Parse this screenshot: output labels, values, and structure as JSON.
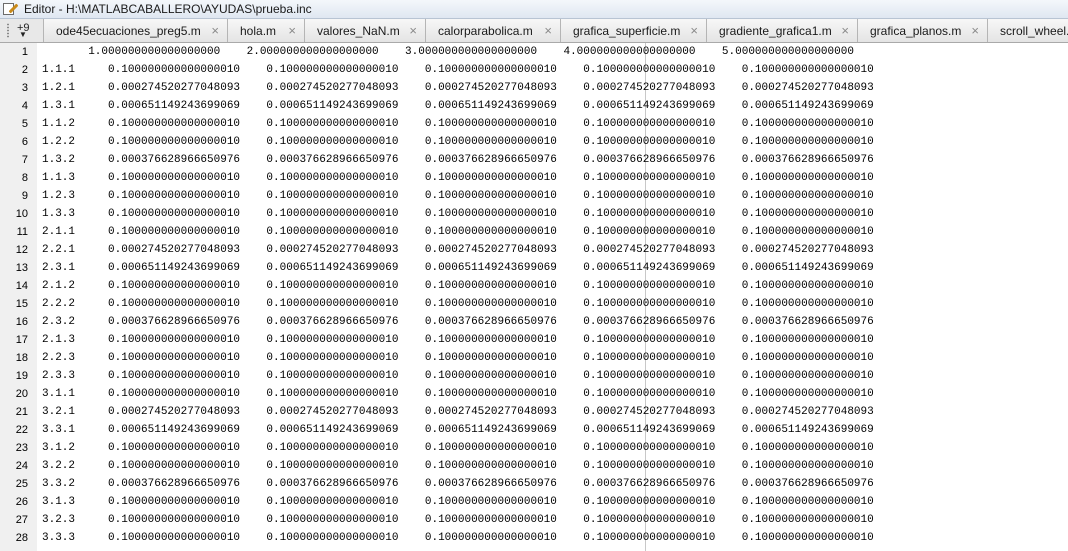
{
  "window": {
    "title": "Editor - H:\\MATLABCABALLERO\\AYUDAS\\prueba.inc"
  },
  "tabbar": {
    "overflow_label": "+9",
    "overflow_arrow": "▼",
    "close_glyph": "×",
    "tabs": [
      {
        "label": "ode45ecuaciones_preg5.m",
        "width": 184
      },
      {
        "label": "hola.m",
        "width": 77
      },
      {
        "label": "valores_NaN.m",
        "width": 121
      },
      {
        "label": "calorparabolica.m",
        "width": 135
      },
      {
        "label": "grafica_superficie.m",
        "width": 146
      },
      {
        "label": "gradiente_grafica1.m",
        "width": 151
      },
      {
        "label": "grafica_planos.m",
        "width": 130
      },
      {
        "label": "scroll_wheel.m",
        "width": 110
      }
    ]
  },
  "editor": {
    "lines": [
      {
        "n": "1",
        "text": "       1.000000000000000000    2.000000000000000000    3.000000000000000000    4.000000000000000000    5.000000000000000000"
      },
      {
        "n": "2",
        "text": "1.1.1     0.100000000000000010    0.100000000000000010    0.100000000000000010    0.100000000000000010    0.100000000000000010"
      },
      {
        "n": "3",
        "text": "1.2.1     0.000274520277048093    0.000274520277048093    0.000274520277048093    0.000274520277048093    0.000274520277048093"
      },
      {
        "n": "4",
        "text": "1.3.1     0.000651149243699069    0.000651149243699069    0.000651149243699069    0.000651149243699069    0.000651149243699069"
      },
      {
        "n": "5",
        "text": "1.1.2     0.100000000000000010    0.100000000000000010    0.100000000000000010    0.100000000000000010    0.100000000000000010"
      },
      {
        "n": "6",
        "text": "1.2.2     0.100000000000000010    0.100000000000000010    0.100000000000000010    0.100000000000000010    0.100000000000000010"
      },
      {
        "n": "7",
        "text": "1.3.2     0.000376628966650976    0.000376628966650976    0.000376628966650976    0.000376628966650976    0.000376628966650976"
      },
      {
        "n": "8",
        "text": "1.1.3     0.100000000000000010    0.100000000000000010    0.100000000000000010    0.100000000000000010    0.100000000000000010"
      },
      {
        "n": "9",
        "text": "1.2.3     0.100000000000000010    0.100000000000000010    0.100000000000000010    0.100000000000000010    0.100000000000000010"
      },
      {
        "n": "10",
        "text": "1.3.3     0.100000000000000010    0.100000000000000010    0.100000000000000010    0.100000000000000010    0.100000000000000010"
      },
      {
        "n": "11",
        "text": "2.1.1     0.100000000000000010    0.100000000000000010    0.100000000000000010    0.100000000000000010    0.100000000000000010"
      },
      {
        "n": "12",
        "text": "2.2.1     0.000274520277048093    0.000274520277048093    0.000274520277048093    0.000274520277048093    0.000274520277048093"
      },
      {
        "n": "13",
        "text": "2.3.1     0.000651149243699069    0.000651149243699069    0.000651149243699069    0.000651149243699069    0.000651149243699069"
      },
      {
        "n": "14",
        "text": "2.1.2     0.100000000000000010    0.100000000000000010    0.100000000000000010    0.100000000000000010    0.100000000000000010"
      },
      {
        "n": "15",
        "text": "2.2.2     0.100000000000000010    0.100000000000000010    0.100000000000000010    0.100000000000000010    0.100000000000000010"
      },
      {
        "n": "16",
        "text": "2.3.2     0.000376628966650976    0.000376628966650976    0.000376628966650976    0.000376628966650976    0.000376628966650976"
      },
      {
        "n": "17",
        "text": "2.1.3     0.100000000000000010    0.100000000000000010    0.100000000000000010    0.100000000000000010    0.100000000000000010"
      },
      {
        "n": "18",
        "text": "2.2.3     0.100000000000000010    0.100000000000000010    0.100000000000000010    0.100000000000000010    0.100000000000000010"
      },
      {
        "n": "19",
        "text": "2.3.3     0.100000000000000010    0.100000000000000010    0.100000000000000010    0.100000000000000010    0.100000000000000010"
      },
      {
        "n": "20",
        "text": "3.1.1     0.100000000000000010    0.100000000000000010    0.100000000000000010    0.100000000000000010    0.100000000000000010"
      },
      {
        "n": "21",
        "text": "3.2.1     0.000274520277048093    0.000274520277048093    0.000274520277048093    0.000274520277048093    0.000274520277048093"
      },
      {
        "n": "22",
        "text": "3.3.1     0.000651149243699069    0.000651149243699069    0.000651149243699069    0.000651149243699069    0.000651149243699069"
      },
      {
        "n": "23",
        "text": "3.1.2     0.100000000000000010    0.100000000000000010    0.100000000000000010    0.100000000000000010    0.100000000000000010"
      },
      {
        "n": "24",
        "text": "3.2.2     0.100000000000000010    0.100000000000000010    0.100000000000000010    0.100000000000000010    0.100000000000000010"
      },
      {
        "n": "25",
        "text": "3.3.2     0.000376628966650976    0.000376628966650976    0.000376628966650976    0.000376628966650976    0.000376628966650976"
      },
      {
        "n": "26",
        "text": "3.1.3     0.100000000000000010    0.100000000000000010    0.100000000000000010    0.100000000000000010    0.100000000000000010"
      },
      {
        "n": "27",
        "text": "3.2.3     0.100000000000000010    0.100000000000000010    0.100000000000000010    0.100000000000000010    0.100000000000000010"
      },
      {
        "n": "28",
        "text": "3.3.3     0.100000000000000010    0.100000000000000010    0.100000000000000010    0.100000000000000010    0.100000000000000010"
      }
    ]
  }
}
